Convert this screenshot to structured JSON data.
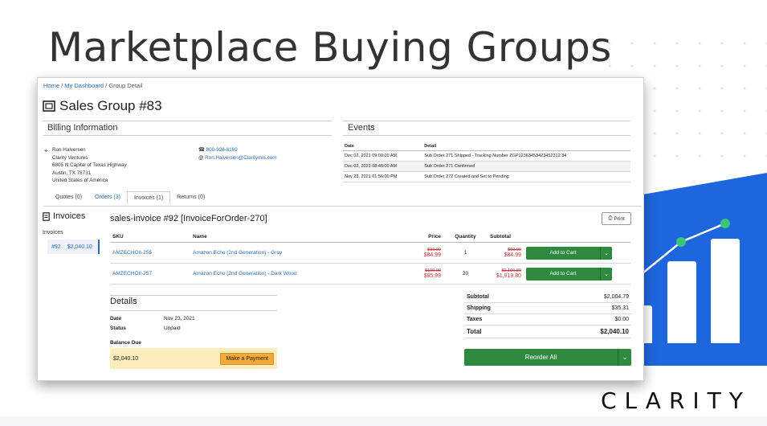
{
  "slide": {
    "title": "Marketplace Buying Groups",
    "logo": "CLARITY"
  },
  "breadcrumb": {
    "home": "Home",
    "dashboard": "My Dashboard",
    "current": "Group Detail"
  },
  "group": {
    "title": "Sales Group #83"
  },
  "billing": {
    "heading": "Billing Information",
    "address_lines": [
      "Ron Halversen",
      "Clarity Ventures",
      "6805 N Capital of Texas Highway",
      "Austin, TX 78731",
      "United States of America"
    ],
    "phone": "800-928-8169",
    "email": "Ron.Halversen@Claritymis.com"
  },
  "events": {
    "heading": "Events",
    "columns": [
      "Date",
      "Detail"
    ],
    "rows": [
      [
        "Dec 02, 2021 09:00:00 AM",
        "Sub Order 271 Shipped - Tracking Number ZGP12363453423452312 34"
      ],
      [
        "Dec 02, 2021 08:45:00 AM",
        "Sub Order 271 Confirmed"
      ],
      [
        "Nov 23, 2021 01:56:00 PM",
        "Sub Order 272 Created and Set to Pending"
      ]
    ]
  },
  "tabs": [
    {
      "label": "Quotes (0)"
    },
    {
      "label": "Orders (3)"
    },
    {
      "label": "Invoices (1)"
    },
    {
      "label": "Returns (0)"
    }
  ],
  "invoices_sidebar": {
    "heading": "Invoices",
    "label": "Invoices",
    "item_id": "#92",
    "item_amount": "$2,040.10"
  },
  "invoice": {
    "title": "sales-invoice #92 [InvoiceForOrder-270]",
    "print": "Print",
    "columns": [
      "SKU",
      "Name",
      "Price",
      "Quantity",
      "Subtotal"
    ],
    "rows": [
      {
        "sku": "AMZECHOII-255",
        "name": "Amazon Echo (2nd Generation) - Gray",
        "old_price": "$99.99",
        "price": "$84.99",
        "qty": "1",
        "old_subtotal": "$99.99",
        "subtotal": "$84.99",
        "action": "Add to Cart"
      },
      {
        "sku": "AMZECHOII-257",
        "name": "Amazon Echo (2nd Generation) - Dark Wood",
        "old_price": "$109.99",
        "price": "$95.99",
        "qty": "20",
        "old_subtotal": "$2,199.80",
        "subtotal": "$1,919.80",
        "action": "Add to Cart"
      }
    ]
  },
  "details": {
    "heading": "Details",
    "date_label": "Date",
    "date_value": "Nov 23, 2021",
    "status_label": "Status",
    "status_value": "Unpaid",
    "balance_label": "Balance Due",
    "balance_value": "$2,040.10",
    "pay_button": "Make a Payment"
  },
  "totals": {
    "subtotal_label": "Subtotal",
    "subtotal": "$2,004.79",
    "shipping_label": "Shipping",
    "shipping": "$35.31",
    "taxes_label": "Taxes",
    "taxes": "$0.00",
    "total_label": "Total",
    "total": "$2,040.10",
    "reorder": "Reorder All"
  }
}
